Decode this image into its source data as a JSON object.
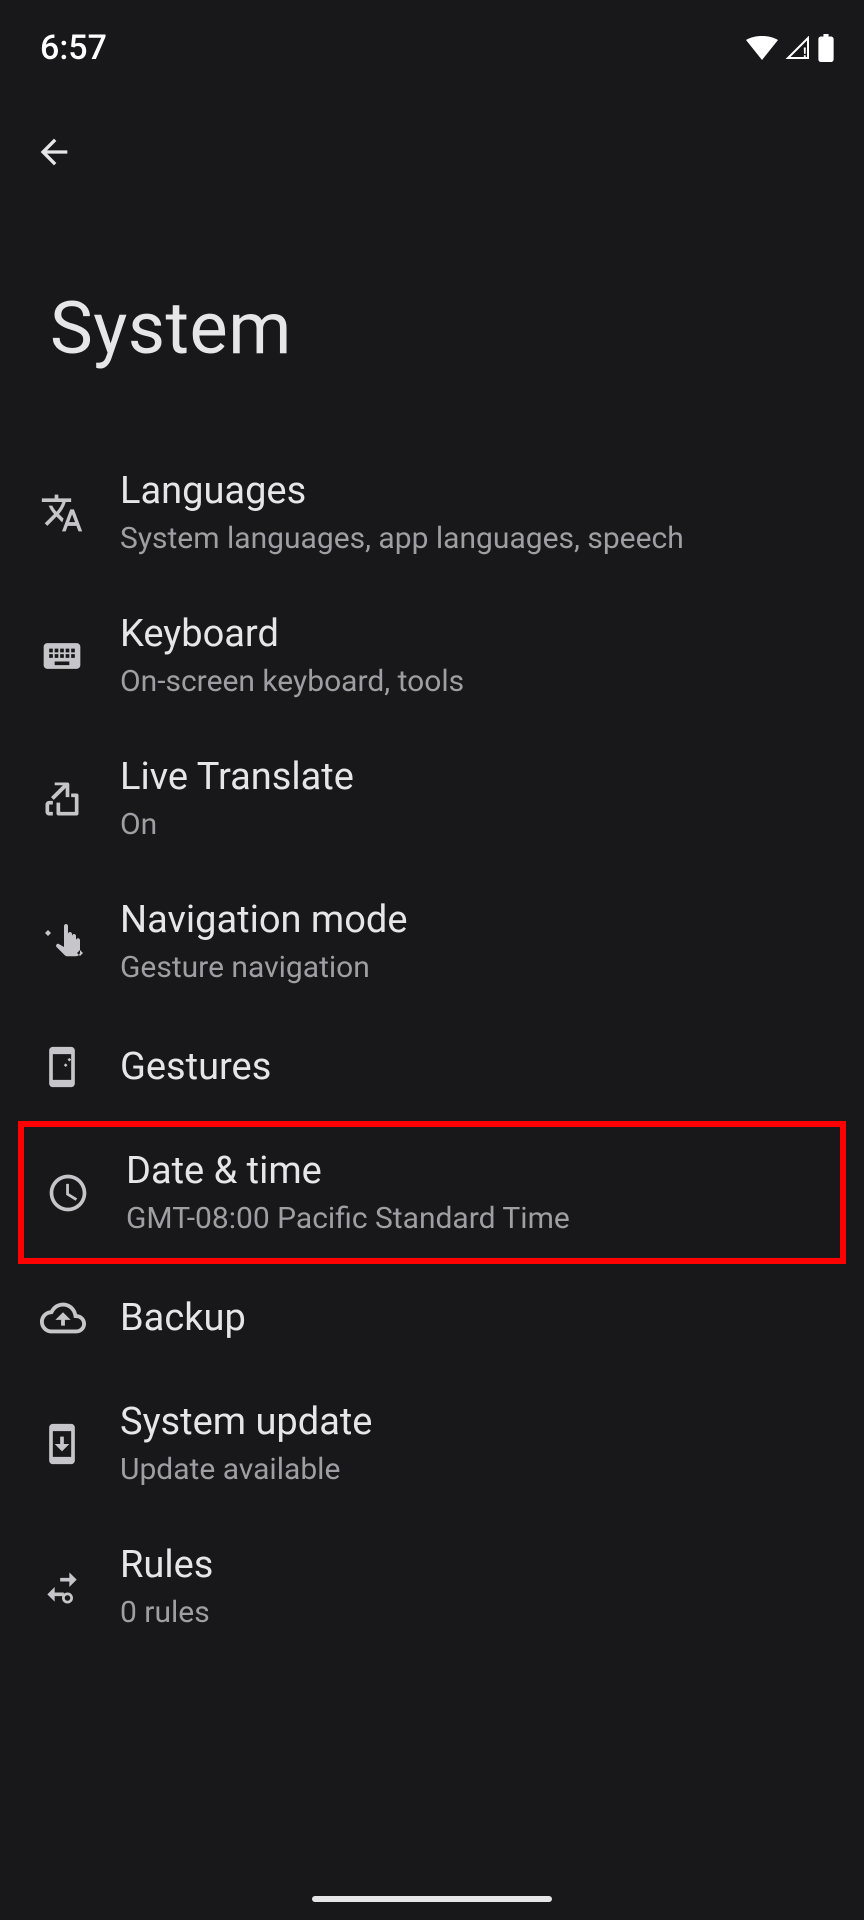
{
  "status": {
    "time": "6:57"
  },
  "header": {
    "title": "System"
  },
  "items": [
    {
      "title": "Languages",
      "subtitle": "System languages, app languages, speech"
    },
    {
      "title": "Keyboard",
      "subtitle": "On-screen keyboard, tools"
    },
    {
      "title": "Live Translate",
      "subtitle": "On"
    },
    {
      "title": "Navigation mode",
      "subtitle": "Gesture navigation"
    },
    {
      "title": "Gestures",
      "subtitle": ""
    },
    {
      "title": "Date & time",
      "subtitle": "GMT-08:00 Pacific Standard Time"
    },
    {
      "title": "Backup",
      "subtitle": ""
    },
    {
      "title": "System update",
      "subtitle": "Update available"
    },
    {
      "title": "Rules",
      "subtitle": "0 rules"
    }
  ]
}
